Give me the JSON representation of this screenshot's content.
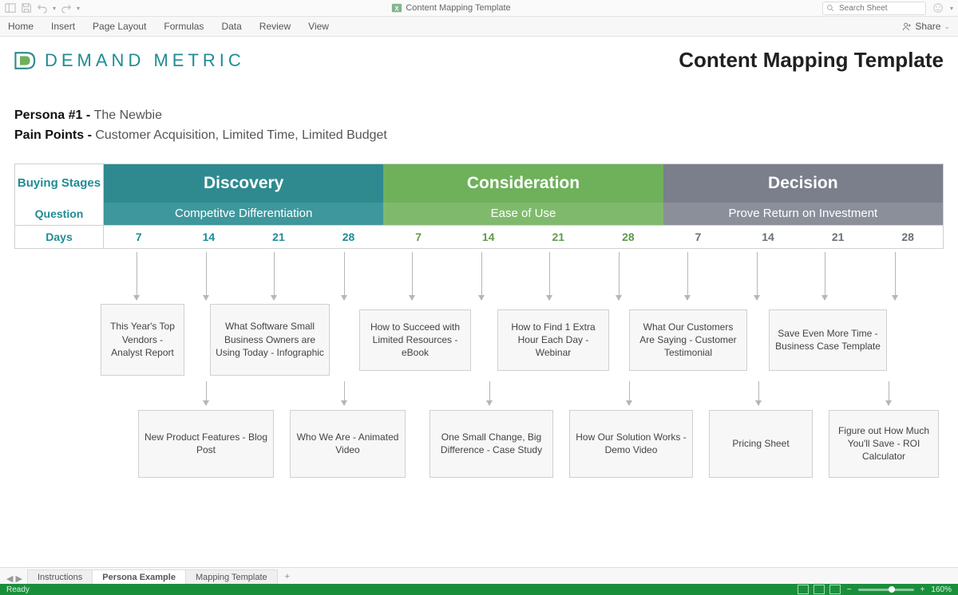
{
  "titlebar": {
    "doc_title": "Content Mapping Template",
    "search_placeholder": "Search Sheet"
  },
  "ribbon": {
    "tabs": [
      "Home",
      "Insert",
      "Page Layout",
      "Formulas",
      "Data",
      "Review",
      "View"
    ],
    "share_label": "Share"
  },
  "brand": {
    "logo_text": "DEMAND METRIC",
    "page_title": "Content Mapping Template"
  },
  "persona": {
    "label1": "Persona #1 - ",
    "value1": "The Newbie",
    "label2": "Pain Points - ",
    "value2": "Customer Acquisition, Limited Time, Limited Budget"
  },
  "table": {
    "row_labels": {
      "stages": "Buying Stages",
      "question": "Question",
      "days": "Days"
    },
    "stages": [
      {
        "title": "Discovery",
        "question": "Competitve Differentiation",
        "color": "teal"
      },
      {
        "title": "Consideration",
        "question": "Ease of Use",
        "color": "green"
      },
      {
        "title": "Decision",
        "question": "Prove Return on Investment",
        "color": "grey"
      }
    ],
    "days": [
      "7",
      "14",
      "21",
      "28"
    ]
  },
  "content_boxes": {
    "b1": "This Year's Top Vendors - Analyst Report",
    "b2": "What Software Small Business Owners are Using Today - Infographic",
    "b3": "New Product Features - Blog Post",
    "b4": "Who We Are - Animated Video",
    "b5": "How to Succeed with Limited Resources - eBook",
    "b6": "How to Find 1 Extra Hour Each Day - Webinar",
    "b7": "One Small Change, Big Difference - Case Study",
    "b8": "How Our Solution Works - Demo Video",
    "b9": "What Our Customers Are Saying - Customer Testimonial",
    "b10": "Save Even More Time - Business Case Template",
    "b11": "Pricing Sheet",
    "b12": "Figure out How Much You'll Save - ROI Calculator"
  },
  "sheet_tabs": {
    "tabs": [
      "Instructions",
      "Persona Example",
      "Mapping Template"
    ],
    "active_index": 1,
    "add": "+"
  },
  "statusbar": {
    "ready": "Ready",
    "zoom": "160%",
    "minus": "−",
    "plus": "+"
  }
}
